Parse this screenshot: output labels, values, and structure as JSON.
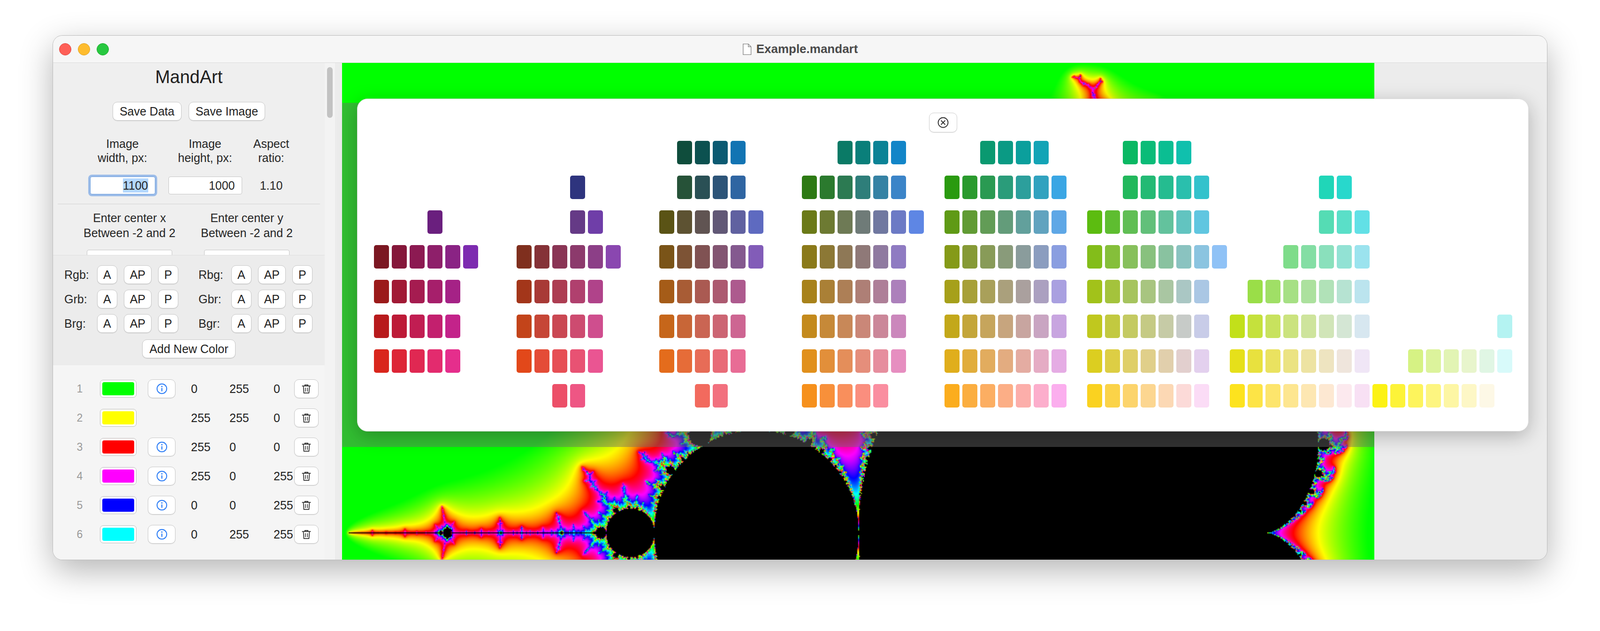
{
  "window": {
    "title": "Example.mandart"
  },
  "sidebar": {
    "title": "MandArt",
    "buttons": [
      "Save Data",
      "Save Image"
    ],
    "image_size": [
      {
        "label": "Image width, px:",
        "value": "1100",
        "kind": "field",
        "focused": true
      },
      {
        "label": "Image height, px:",
        "value": "1000",
        "kind": "field",
        "focused": false
      },
      {
        "label": "Aspect ratio:",
        "value": "1.10",
        "kind": "text",
        "focused": false
      }
    ],
    "center": [
      {
        "label": "Enter center x",
        "hint": "Between -2 and 2"
      },
      {
        "label": "Enter center y",
        "hint": "Between -2 and 2"
      }
    ],
    "orderings": [
      {
        "label": "Rgb:",
        "buttons": [
          "A",
          "AP",
          "P"
        ]
      },
      {
        "label": "Rbg:",
        "buttons": [
          "A",
          "AP",
          "P"
        ]
      },
      {
        "label": "Grb:",
        "buttons": [
          "A",
          "AP",
          "P"
        ]
      },
      {
        "label": "Gbr:",
        "buttons": [
          "A",
          "AP",
          "P"
        ]
      },
      {
        "label": "Brg:",
        "buttons": [
          "A",
          "AP",
          "P"
        ]
      },
      {
        "label": "Bgr:",
        "buttons": [
          "A",
          "AP",
          "P"
        ]
      }
    ],
    "add_button": "Add New Color",
    "colors": [
      {
        "index": "1",
        "color": "#00ff00",
        "r": "0",
        "g": "255",
        "b": "0",
        "info": true
      },
      {
        "index": "2",
        "color": "#ffff00",
        "r": "255",
        "g": "255",
        "b": "0",
        "info": false
      },
      {
        "index": "3",
        "color": "#ff0000",
        "r": "255",
        "g": "0",
        "b": "0",
        "info": true
      },
      {
        "index": "4",
        "color": "#ff00ff",
        "r": "255",
        "g": "0",
        "b": "255",
        "info": true
      },
      {
        "index": "5",
        "color": "#0000ff",
        "r": "0",
        "g": "0",
        "b": "255",
        "info": true
      },
      {
        "index": "6",
        "color": "#00ffff",
        "r": "0",
        "g": "255",
        "b": "255",
        "info": true
      }
    ]
  },
  "palette": {
    "groups": [
      {
        "rows": [
          [],
          [],
          [
            "",
            "",
            "",
            "#6a1f7e"
          ],
          [
            "#7b1722",
            "#85173a",
            "#8c1a52",
            "#8e1f6a",
            "#8a2384",
            "#7d2bb0"
          ],
          [
            "#9b1a1a",
            "#a11a35",
            "#a51c50",
            "#a61f6b",
            "#a52286"
          ],
          [
            "#b81a1c",
            "#bd1a37",
            "#c11d52",
            "#c3206e",
            "#c3238a"
          ],
          [
            "#d9261c",
            "#dd2536",
            "#e02852",
            "#e32b6e",
            "#e52e8c"
          ],
          []
        ]
      },
      {
        "rows": [
          [],
          [
            "",
            "",
            "",
            "#2e347e"
          ],
          [
            "",
            "",
            "",
            "#653a86",
            "#6f3ea8"
          ],
          [
            "#7f2f1e",
            "#853237",
            "#8a3555",
            "#8c3a6c",
            "#8c3f87",
            "#8a47b0"
          ],
          [
            "#a3361a",
            "#a83a36",
            "#ad3d52",
            "#b0406e",
            "#b0438a"
          ],
          [
            "#c3441a",
            "#c64636",
            "#ca4853",
            "#cd4b70",
            "#cf4e8e"
          ],
          [
            "#e2481a",
            "#e44c37",
            "#e64f55",
            "#e85273",
            "#ea5592"
          ],
          [
            "",
            "",
            "#ec4f68",
            "#ee5684"
          ]
        ]
      },
      {
        "rows": [
          [
            "",
            "#0f4d3c",
            "#0c5150",
            "#0c5a72",
            "#1274b3"
          ],
          [
            "",
            "#265238",
            "#2a5055",
            "#2d5478",
            "#2f65a2"
          ],
          [
            "#5a5315",
            "#5d5232",
            "#605452",
            "#615876",
            "#6061a0",
            "#5e6ac0"
          ],
          [
            "#7a5418",
            "#7d5335",
            "#805253",
            "#835572",
            "#84598f",
            "#825cb8"
          ],
          [
            "#a55c18",
            "#a85c35",
            "#aa5a52",
            "#ac5a70",
            "#ad5a8e"
          ],
          [
            "#c6661a",
            "#c86637",
            "#ca6553",
            "#cc6573",
            "#cd6592"
          ],
          [
            "#e46c1c",
            "#e66c38",
            "#e76c57",
            "#e86b77",
            "#e86c95"
          ],
          [
            "",
            "",
            "#f26a5e",
            "#f2707e"
          ]
        ]
      },
      {
        "rows": [
          [
            "",
            "",
            "#0a7a66",
            "#0a7f7a",
            "#0b8396",
            "#1285c8"
          ],
          [
            "#2d7a14",
            "#2b7a2e",
            "#2c7a52",
            "#2e7e7a",
            "#3582a4",
            "#3b84c8"
          ],
          [
            "#6b7a18",
            "#6d7a32",
            "#6e7a55",
            "#6f7b78",
            "#7078a0",
            "#6c7ac5",
            "#5e86e4"
          ],
          [
            "#8b7a1a",
            "#8c7835",
            "#8e7856",
            "#8f7978",
            "#8f7aa0",
            "#8f7bc2"
          ],
          [
            "#a8821a",
            "#aa8036",
            "#ad7f56",
            "#ae7f76",
            "#ae7f98",
            "#ac80bb"
          ],
          [
            "#c48a1c",
            "#c68938",
            "#c88858",
            "#ca8778",
            "#cb8799",
            "#cb87bc"
          ],
          [
            "#e1901c",
            "#e28f3a",
            "#e48e5a",
            "#e58e7b",
            "#e68e9e",
            "#e68ec0"
          ],
          [
            "#f6901c",
            "#f8903a",
            "#f98f5c",
            "#fa8e7e",
            "#fa8ea0"
          ]
        ]
      },
      {
        "rows": [
          [
            "",
            "",
            "#0a9970",
            "#0a9a84",
            "#0b9f9c",
            "#13a4b6"
          ],
          [
            "#2a9a10",
            "#2a9a2e",
            "#2a9a52",
            "#2a9c7a",
            "#2c9f9c",
            "#31a2bf",
            "#3aa6e4"
          ],
          [
            "#5f9a16",
            "#619b34",
            "#629c56",
            "#639c7a",
            "#62a09c",
            "#61a3bf",
            "#5ea7e6"
          ],
          [
            "#859a18",
            "#869a36",
            "#889b58",
            "#899b7a",
            "#8a9c9c",
            "#8b9dbf",
            "#8a9ee0"
          ],
          [
            "#a6a01a",
            "#a7a038",
            "#a9a05a",
            "#aaa07c",
            "#aaa09e",
            "#aba0c0",
            "#a9a0e0"
          ],
          [
            "#c3a81a",
            "#c4a63a",
            "#c6a55c",
            "#c7a57e",
            "#c8a5a0",
            "#c9a5c2",
            "#c8a5e0"
          ],
          [
            "#e0ae1c",
            "#e1ad3c",
            "#e2ac5e",
            "#e3ac80",
            "#e4aca2",
            "#e5acc4",
            "#e5ace4"
          ],
          [
            "#fbad1e",
            "#fbae40",
            "#fcae62",
            "#fcae86",
            "#fcaeaa",
            "#fcaecc",
            "#fbaeee"
          ]
        ]
      },
      {
        "rows": [
          [
            "",
            "",
            "#0ab863",
            "#0abc78",
            "#0bbe92",
            "#10c0ad"
          ],
          [
            "",
            "",
            "#22b85c",
            "#23ba74",
            "#25bc90",
            "#2abfad",
            "#33c2cc"
          ],
          [
            "#5cbc10",
            "#5ebd30",
            "#60be54",
            "#62c07a",
            "#63c29d",
            "#62c4c0",
            "#60c6e0"
          ],
          [
            "#83bd1a",
            "#85bf3a",
            "#87c05c",
            "#88c17e",
            "#89c2a0",
            "#8ac3c0",
            "#8bc4e0",
            "#8fc2f6"
          ],
          [
            "#a2c21a",
            "#a4c33c",
            "#a6c45e",
            "#a8c580",
            "#a9c6a2",
            "#aac7c4",
            "#aac7e4"
          ],
          [
            "#c0c81e",
            "#c2c940",
            "#c4ca62",
            "#c5ca84",
            "#c6cba6",
            "#c7cbc8",
            "#c8cce8"
          ],
          [
            "#dcce20",
            "#ddce44",
            "#dfcf68",
            "#e0cf8a",
            "#e1cfac",
            "#e2cfce",
            "#e3d0ee"
          ],
          [
            "#fad220",
            "#fbd348",
            "#fcd46c",
            "#fcd690",
            "#fcd8b4",
            "#fcdad8",
            "#fbdcf6"
          ]
        ]
      },
      {
        "rows": [
          [],
          [
            "",
            "",
            "",
            "",
            "",
            "#20d6b8",
            "#28d8cc"
          ],
          [
            "",
            "",
            "",
            "",
            "",
            "#55dcb4",
            "#5adfc8",
            "#62e0e6"
          ],
          [
            "",
            "",
            "",
            "#7edc8a",
            "#84dea4",
            "#8ae0bc",
            "#92e2d4",
            "#9be3ee"
          ],
          [
            "",
            "#9ade48",
            "#a0df66",
            "#a6e084",
            "#ace19e",
            "#b1e2b8",
            "#b6e3d2",
            "#bbe4ee"
          ],
          [
            "#c2e01a",
            "#c5e13c",
            "#c8e25e",
            "#cbe37e",
            "#cee49c",
            "#d1e5b8",
            "#d4e6d4",
            "#d7e7f0"
          ],
          [
            "#e6e01a",
            "#e8e13e",
            "#eae260",
            "#ebe382",
            "#ede3a2",
            "#eee4c0",
            "#efe5dc",
            "#f0e6f6"
          ],
          [
            "#fde31e",
            "#fde446",
            "#fde56c",
            "#fde690",
            "#fde7b2",
            "#fde8d2",
            "#fce9ee",
            "#f8e0f4"
          ]
        ]
      },
      {
        "rows": [
          [],
          [],
          [],
          [],
          [],
          [
            "",
            "",
            "",
            "",
            "",
            "",
            "",
            "#b4f3f2"
          ],
          [
            "",
            "",
            "#d6f284",
            "#dcf39c",
            "#e2f4b4",
            "#e8f5cc",
            "#e0f6e4",
            "#d8fafa"
          ],
          [
            "#fcf214",
            "#fdf338",
            "#fdf45c",
            "#fdf580",
            "#fdf6a4",
            "#fdf7c6",
            "#fdf8e6"
          ]
        ]
      }
    ]
  }
}
